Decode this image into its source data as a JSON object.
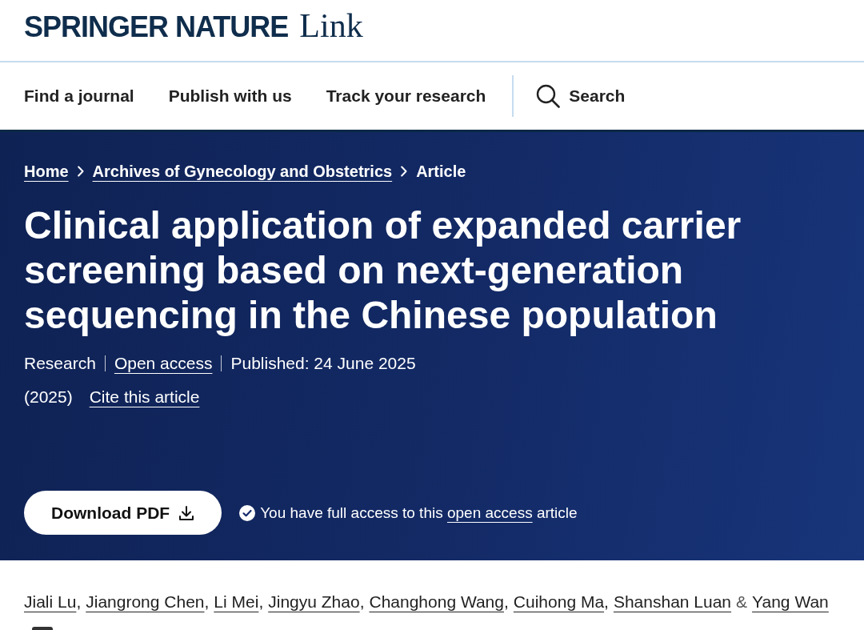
{
  "header": {
    "brand": "SPRINGER NATURE",
    "product": "Link"
  },
  "nav": {
    "items": [
      "Find a journal",
      "Publish with us",
      "Track your research"
    ],
    "search": "Search"
  },
  "breadcrumb": [
    {
      "label": "Home",
      "kind": "link"
    },
    {
      "label": "Archives of Gynecology and Obstetrics",
      "kind": "link"
    },
    {
      "label": "Article",
      "kind": "current"
    }
  ],
  "article": {
    "title": "Clinical application of expanded carrier screening based on next-generation sequencing in the Chinese population",
    "meta": [
      {
        "text": "Research",
        "kind": "text"
      },
      {
        "text": "Open access",
        "kind": "link"
      },
      {
        "text": "Published: 24 June 2025",
        "kind": "text"
      }
    ],
    "citation": [
      {
        "text": "(2025)",
        "kind": "text"
      },
      {
        "text": "Cite this article",
        "kind": "link"
      }
    ],
    "download_button": "Download PDF",
    "access_note": {
      "before": "You have full access to this",
      "link": "open access",
      "after": "article"
    }
  },
  "authors": [
    {
      "name": "Jiali Lu",
      "separator": ","
    },
    {
      "name": "Jiangrong Chen",
      "separator": ","
    },
    {
      "name": "Li Mei",
      "separator": ","
    },
    {
      "name": "Jingyu Zhao",
      "separator": ","
    },
    {
      "name": "Changhong Wang",
      "separator": ","
    },
    {
      "name": "Cuihong Ma",
      "separator": ","
    },
    {
      "name": "Shanshan Luan",
      "separator": "&"
    },
    {
      "name": "Yang Wan"
    }
  ]
}
